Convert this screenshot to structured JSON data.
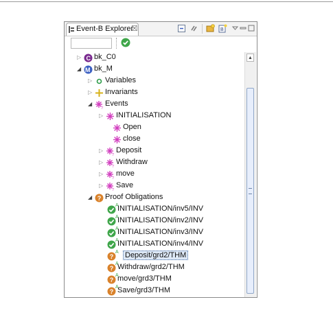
{
  "view": {
    "tab_title": "Event-B Explorer",
    "tab_close": "☒",
    "filter_value": ""
  },
  "tree": {
    "context": {
      "label": "bk_C0",
      "letter": "C"
    },
    "machine": {
      "label": "bk_M",
      "letter": "M"
    },
    "variables": "Variables",
    "invariants": "Invariants",
    "events": "Events",
    "event_items": [
      "INITIALISATION",
      "Open",
      "close",
      "Deposit",
      "Withdraw",
      "move",
      "Save"
    ],
    "proof_obligations": "Proof Obligations",
    "po_items": [
      {
        "label": "INITIALISATION/inv5/INV",
        "status": "proved"
      },
      {
        "label": "INITIALISATION/inv2/INV",
        "status": "proved"
      },
      {
        "label": "INITIALISATION/inv3/INV",
        "status": "proved"
      },
      {
        "label": "INITIALISATION/inv4/INV",
        "status": "proved"
      },
      {
        "label": "Deposit/grd2/THM",
        "status": "unproved",
        "selected": true
      },
      {
        "label": "Withdraw/grd2/THM",
        "status": "unproved"
      },
      {
        "label": "move/grd3/THM",
        "status": "unproved"
      },
      {
        "label": "Save/grd3/THM",
        "status": "unproved"
      }
    ],
    "auto_marker": "A"
  },
  "colors": {
    "context_icon": "#7a2b8f",
    "machine_icon": "#3b5fc2",
    "event_icon": "#d23fbf",
    "proved": "#3fa64a",
    "unproved": "#d9822b",
    "selection": "#dde8f6"
  },
  "icons": {
    "tab": "event-b-explorer-icon",
    "toolbar": [
      "collapse-all-icon",
      "link-editor-icon",
      "new-project-icon",
      "new-component-icon",
      "view-menu-icon",
      "minimize-icon",
      "maximize-icon"
    ],
    "filter_status": "check-icon",
    "context": "context-icon",
    "machine": "machine-icon",
    "variables": "variables-icon",
    "invariants": "invariants-icon",
    "events": "events-icon",
    "proof_obligations": "proof-obligations-icon",
    "po_proved": "proved-check-icon",
    "po_unproved": "unproved-question-icon"
  }
}
